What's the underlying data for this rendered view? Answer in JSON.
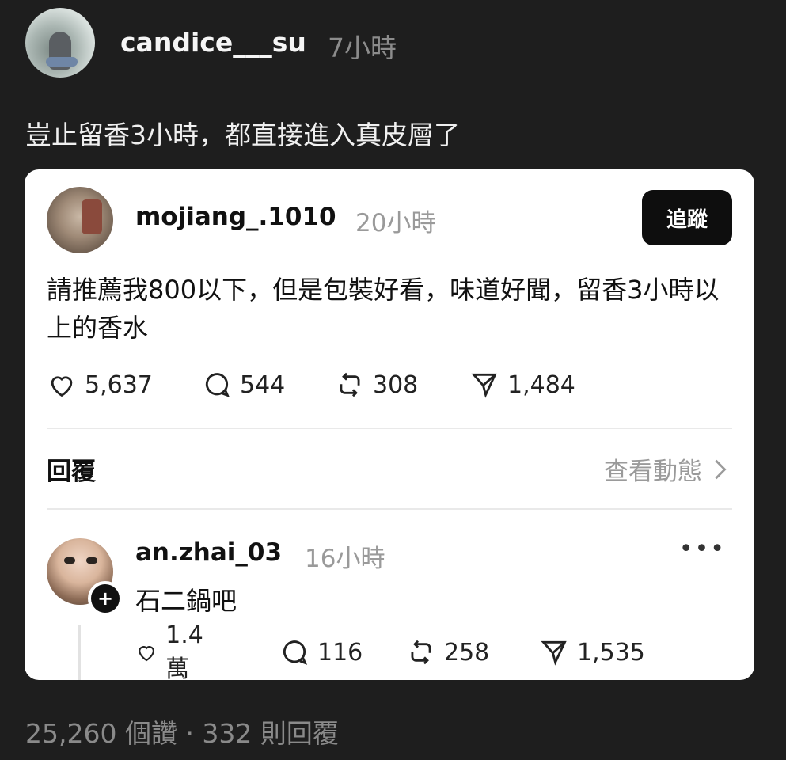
{
  "post": {
    "username": "candice___su",
    "time": "7小時",
    "text": "豈止留香3小時，都直接進入真皮層了"
  },
  "quoted": {
    "username": "mojiang_.1010",
    "time": "20小時",
    "follow_label": "追蹤",
    "text": "請推薦我800以下，但是包裝好看，味道好聞，留香3小時以上的香水",
    "stats": {
      "likes": "5,637",
      "comments": "544",
      "reposts": "308",
      "shares": "1,484"
    },
    "reply_label": "回覆",
    "view_activity_label": "查看動態"
  },
  "reply": {
    "username": "an.zhai_03",
    "time": "16小時",
    "more_label": "•••",
    "text": "石二鍋吧",
    "stats": {
      "likes": "1.4萬",
      "comments": "116",
      "reposts": "258",
      "shares": "1,535"
    }
  },
  "footer": {
    "summary": "25,260 個讚 · 332 則回覆"
  },
  "icons": [
    "heart-icon",
    "comment-icon",
    "repost-icon",
    "share-icon",
    "chevron-right-icon",
    "plus-icon",
    "more-icon"
  ]
}
